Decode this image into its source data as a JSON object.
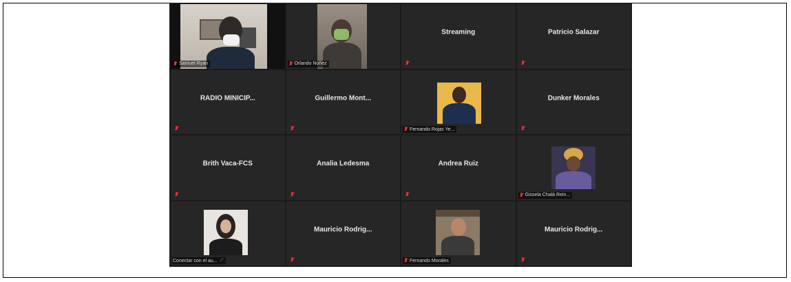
{
  "tiles": [
    {
      "name": "Samuel Ryan",
      "video": true
    },
    {
      "name": "Orlando Núñez",
      "video": true
    },
    {
      "name": "Streaming",
      "video": false
    },
    {
      "name": "Patricio Salazar",
      "video": false
    },
    {
      "name": "RADIO MINICIP...",
      "video": false
    },
    {
      "name": "Guillermo  Mont...",
      "video": false
    },
    {
      "name": "Fernando Rojas Ye...",
      "video": true
    },
    {
      "name": "Dunker Morales",
      "video": false
    },
    {
      "name": "Brith Vaca-FCS",
      "video": false
    },
    {
      "name": "Analia Ledesma",
      "video": false
    },
    {
      "name": "Andrea Ruiz",
      "video": false
    },
    {
      "name": "Gissela Chalá Rein...",
      "video": true
    },
    {
      "name": "Conectar con el au...",
      "video": true
    },
    {
      "name": "Mauricio  Rodrig...",
      "video": false
    },
    {
      "name": "Fernando Morales",
      "video": true
    },
    {
      "name": "Mauricio  Rodrig...",
      "video": false
    }
  ],
  "colors": {
    "mic_muted": "#e0303a",
    "tile_bg": "#262626",
    "grid_bg": "#1a1a1a"
  }
}
